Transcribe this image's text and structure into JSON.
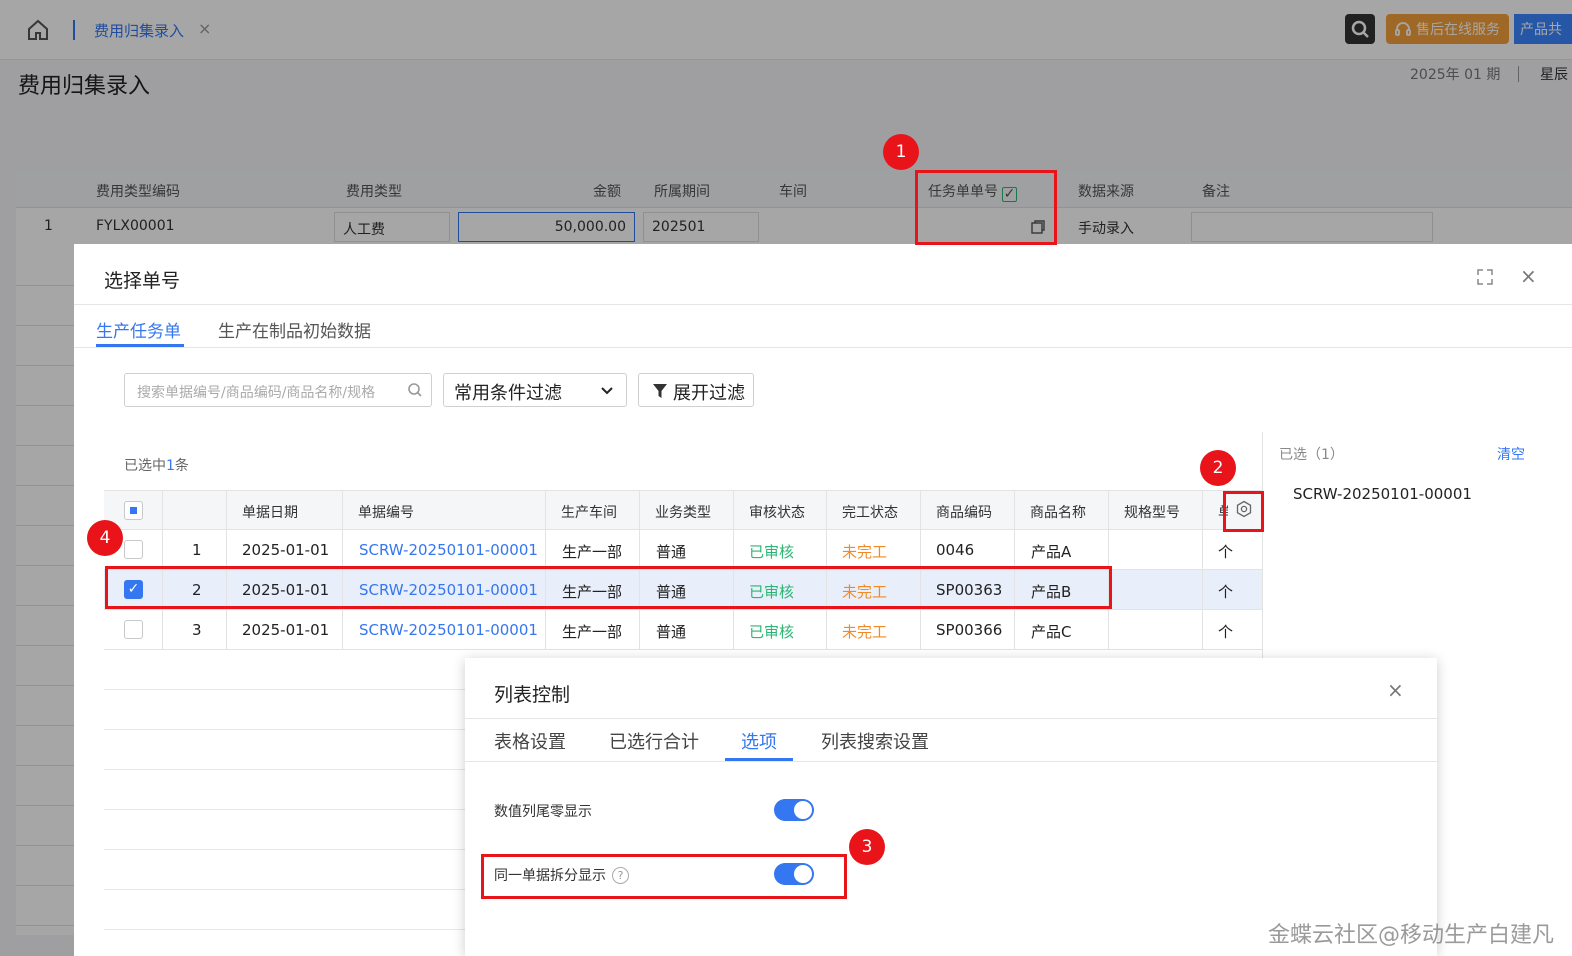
{
  "topbar": {
    "tab_label": "费用归集录入",
    "tab_close": "×",
    "service_label": "售后在线服务",
    "product_label": "产品共"
  },
  "page": {
    "title": "费用归集录入",
    "period": "2025年 01 期",
    "weekday": "星辰"
  },
  "grid": {
    "headers": [
      "费用类型编码",
      "费用类型",
      "金额",
      "所属期间",
      "车间",
      "任务单单号",
      "数据来源",
      "备注"
    ],
    "task_check": "✓",
    "row": {
      "index": "1",
      "code": "FYLX00001",
      "type": "人工费",
      "amount": "50,000.00",
      "period": "202501",
      "workshop": "",
      "task_no": "",
      "source": "手动录入",
      "remark": ""
    }
  },
  "dialog": {
    "title": "选择单号",
    "close": "×",
    "tabs": [
      {
        "label": "生产任务单",
        "active": true
      },
      {
        "label": "生产在制品初始数据",
        "active": false
      }
    ],
    "search_placeholder": "搜索单据编号/商品编码/商品名称/规格",
    "filter_select": "常用条件过滤",
    "expand_filter": "展开过滤",
    "selected_prefix": "已选中",
    "selected_count": "1",
    "selected_suffix": "条",
    "columns": [
      "单据日期",
      "单据编号",
      "生产车间",
      "业务类型",
      "审核状态",
      "完工状态",
      "商品编码",
      "商品名称",
      "规格型号",
      "单"
    ],
    "rows": [
      {
        "no": "1",
        "date": "2025-01-01",
        "bill": "SCRW-20250101-00001",
        "workshop": "生产一部",
        "biz": "普通",
        "audit": "已审核",
        "finish": "未完工",
        "code": "0046",
        "name": "产品A",
        "spec": "",
        "unit": "个",
        "checked": false
      },
      {
        "no": "2",
        "date": "2025-01-01",
        "bill": "SCRW-20250101-00001",
        "workshop": "生产一部",
        "biz": "普通",
        "audit": "已审核",
        "finish": "未完工",
        "code": "SP00363",
        "name": "产品B",
        "spec": "",
        "unit": "个",
        "checked": true
      },
      {
        "no": "3",
        "date": "2025-01-01",
        "bill": "SCRW-20250101-00001",
        "workshop": "生产一部",
        "biz": "普通",
        "audit": "已审核",
        "finish": "未完工",
        "code": "SP00366",
        "name": "产品C",
        "spec": "",
        "unit": "个",
        "checked": false
      }
    ],
    "side": {
      "title": "已选（1）",
      "clear": "清空",
      "items": [
        "SCRW-20250101-00001"
      ]
    }
  },
  "popup": {
    "title": "列表控制",
    "close": "×",
    "tabs": [
      {
        "label": "表格设置",
        "active": false
      },
      {
        "label": "已选行合计",
        "active": false
      },
      {
        "label": "选项",
        "active": true
      },
      {
        "label": "列表搜索设置",
        "active": false
      }
    ],
    "options": [
      {
        "label": "数值列尾零显示",
        "on": true
      },
      {
        "label": "同一单据拆分显示",
        "on": true,
        "help": "?"
      }
    ]
  },
  "annotations": [
    "1",
    "2",
    "3",
    "4"
  ],
  "watermark": "金蝶云社区@移动生产白建凡",
  "colors": {
    "primary": "#3477f0",
    "audited": "#2bb673",
    "unfinished": "#f08a24",
    "annotation": "#e8141a",
    "service": "#f5a03b"
  }
}
